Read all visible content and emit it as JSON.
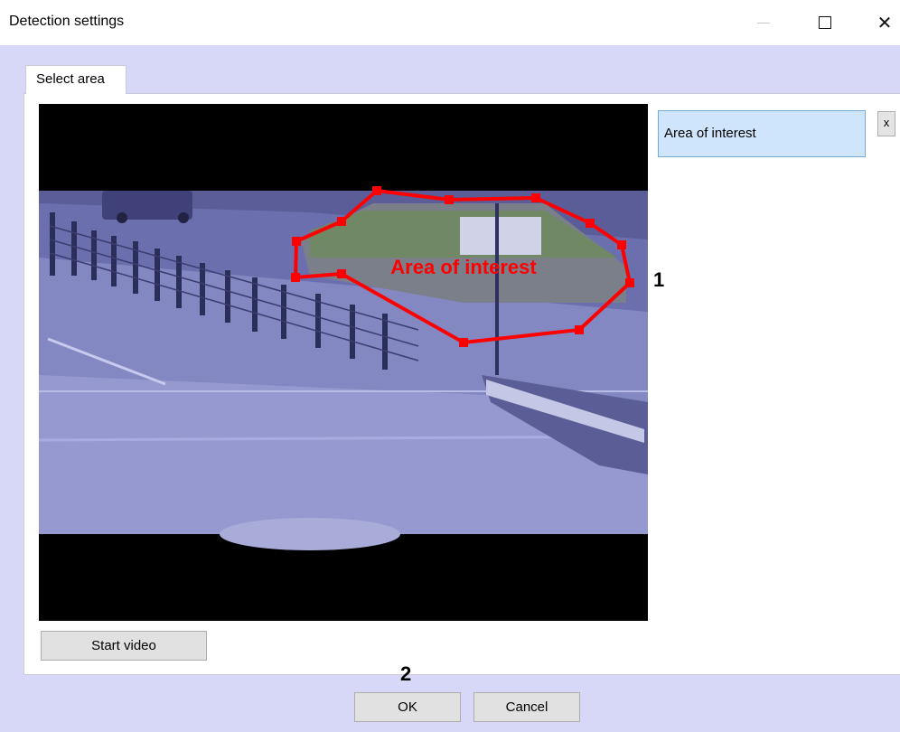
{
  "window": {
    "title": "Detection settings",
    "controls": {
      "minimize": "—",
      "close": "✕"
    }
  },
  "tabs": [
    {
      "label": "Select area"
    }
  ],
  "areas": [
    {
      "label": "Area of interest"
    }
  ],
  "overlay": {
    "label": "Area of interest",
    "color": "#ff0000"
  },
  "remove_button": {
    "label": "x"
  },
  "buttons": {
    "start_video": "Start video",
    "ok": "OK",
    "cancel": "Cancel"
  },
  "callouts": {
    "one": "1",
    "two": "2"
  },
  "colors": {
    "dialog_bg": "#d7d7f7",
    "selected_area_bg": "#cfe5fb"
  }
}
